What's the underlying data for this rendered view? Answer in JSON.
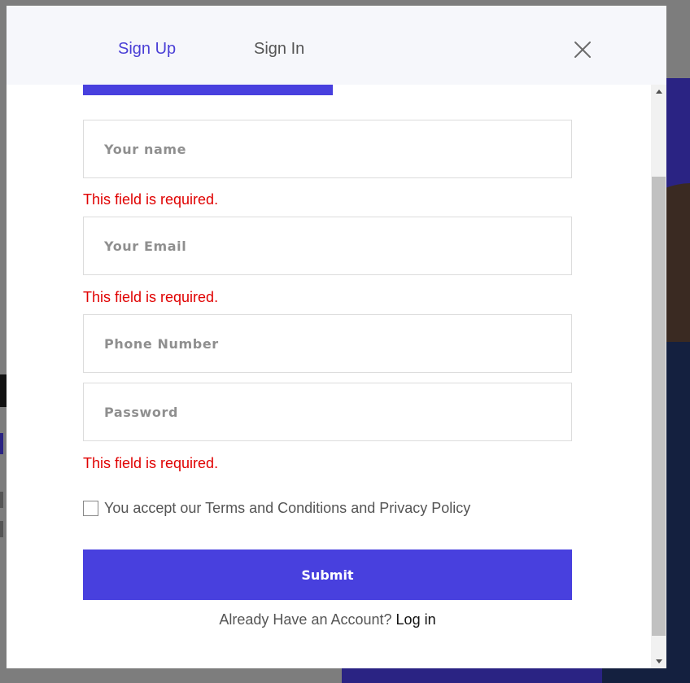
{
  "header": {
    "tabs": [
      {
        "label": "Sign Up",
        "active": true
      },
      {
        "label": "Sign In",
        "active": false
      }
    ],
    "close_icon": "close-icon"
  },
  "form": {
    "name_placeholder": "Your name",
    "email_placeholder": "Your Email",
    "phone_placeholder": "Phone Number",
    "password_placeholder": "Password",
    "name_error": "This field is required.",
    "email_error": "This field is required.",
    "password_error": "This field is required.",
    "terms_label": "You accept our Terms and Conditions and Privacy Policy",
    "terms_checked": false,
    "submit_label": "Submit",
    "login_prompt": "Already Have an Account?",
    "login_link": "Log in"
  },
  "colors": {
    "accent": "#4840de",
    "error": "#e00000",
    "header_bg": "#f6f7fb"
  }
}
